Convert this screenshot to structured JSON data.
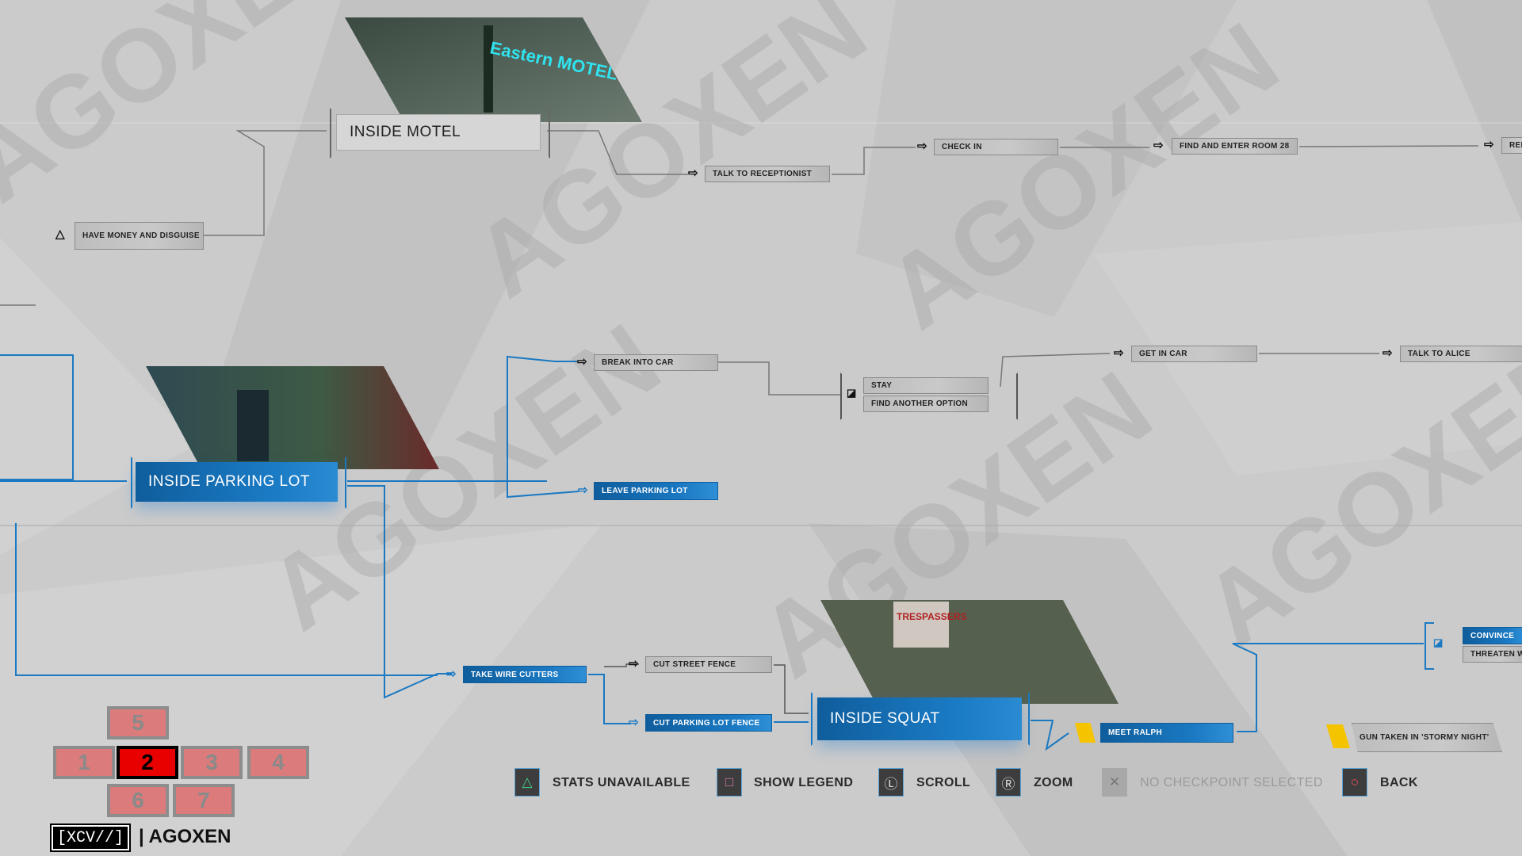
{
  "scenes": {
    "motel": {
      "label": "INSIDE MOTEL"
    },
    "parking": {
      "label": "INSIDE PARKING LOT"
    },
    "squat": {
      "label": "INSIDE SQUAT"
    }
  },
  "nodes": {
    "have_money": "HAVE MONEY AND DISGUISE",
    "talk_receptionist": "TALK TO RECEPTIONIST",
    "check_in": "CHECK IN",
    "find_room": "FIND AND ENTER ROOM 28",
    "ren": "REN",
    "break_car": "BREAK INTO CAR",
    "stay": "STAY",
    "find_option": "FIND ANOTHER OPTION",
    "get_in_car": "GET IN CAR",
    "talk_alice": "TALK TO ALICE",
    "leave_parking": "LEAVE PARKING LOT",
    "take_cutters": "TAKE WIRE CUTTERS",
    "cut_street": "CUT STREET FENCE",
    "cut_parking": "CUT PARKING LOT FENCE",
    "meet_ralph": "MEET RALPH",
    "gun_taken": "GUN TAKEN IN 'STORMY NIGHT'",
    "convince": "CONVINCE",
    "threaten": "THREATEN W"
  },
  "motel_sign": "Eastern MOTEL",
  "chapters": {
    "items": [
      "5",
      "1",
      "2",
      "3",
      "4",
      "6",
      "7"
    ],
    "selected": "2"
  },
  "logo": {
    "mark": "[XCV//]",
    "name": "| AGOXEN"
  },
  "watermark": "AGOXEN",
  "controls": [
    {
      "icon": "triangle-icon",
      "glyph": "△",
      "label": "STATS UNAVAILABLE",
      "color": "#3fd08a"
    },
    {
      "icon": "square-icon",
      "glyph": "□",
      "label": "SHOW LEGEND",
      "color": "#e57bb5"
    },
    {
      "icon": "left-stick-icon",
      "glyph": "Ⓛ",
      "label": "SCROLL",
      "color": "#dddddd"
    },
    {
      "icon": "right-stick-icon",
      "glyph": "Ⓡ",
      "label": "ZOOM",
      "color": "#dddddd"
    },
    {
      "icon": "cross-icon",
      "glyph": "✕",
      "label": "NO CHECKPOINT SELECTED",
      "color": "#9a9a9a"
    },
    {
      "icon": "circle-icon",
      "glyph": "○",
      "label": "BACK",
      "color": "#ff5060"
    }
  ],
  "colors": {
    "accent": "#1a79c2",
    "lock": "#f5c400",
    "selected_chapter": "#e80000"
  }
}
